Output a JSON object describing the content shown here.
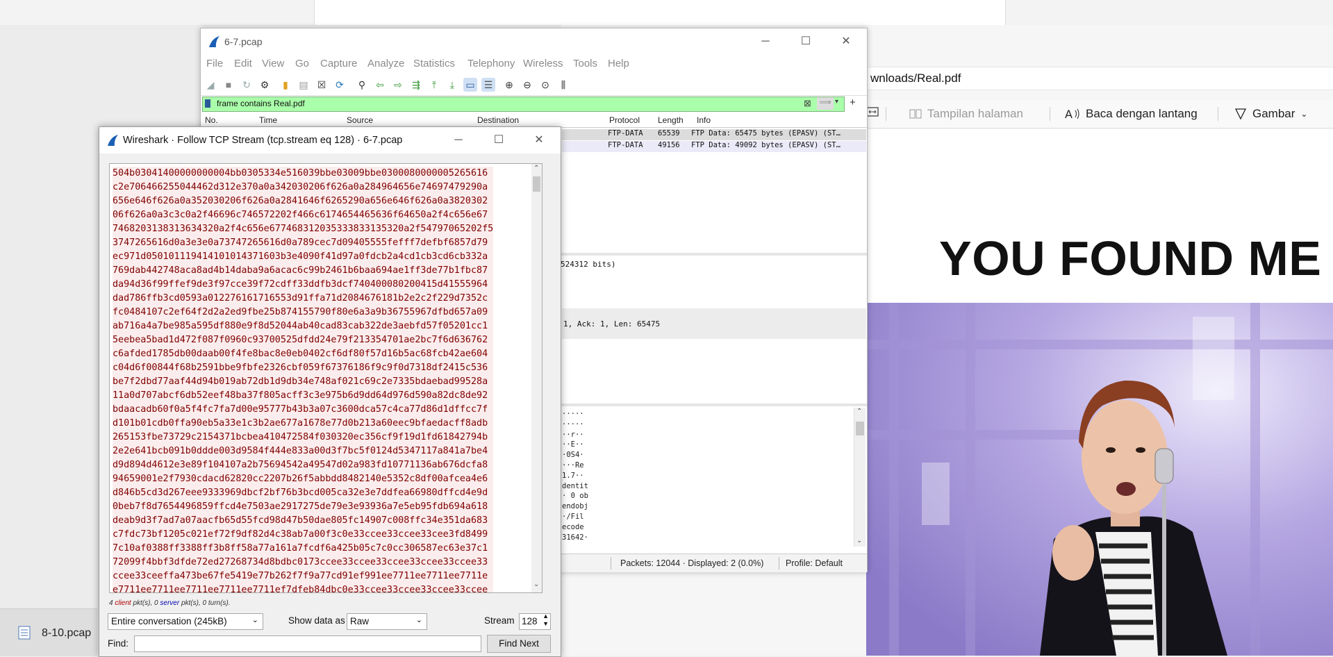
{
  "browser": {
    "address_fragment": "wnloads/Real.pdf",
    "toolbar": {
      "view_label": "Tampilan halaman",
      "read_aloud_label": "Baca dengan lantang",
      "draw_label": "Gambar"
    },
    "pdf_heading": "YOU FOUND ME"
  },
  "taskbar": {
    "item_label": "8-10.pcap"
  },
  "wireshark": {
    "title": "6-7.pcap",
    "menu": [
      "File",
      "Edit",
      "View",
      "Go",
      "Capture",
      "Analyze",
      "Statistics",
      "Telephony",
      "Wireless",
      "Tools",
      "Help"
    ],
    "filter": "frame contains Real.pdf",
    "columns": [
      "No.",
      "Time",
      "Source",
      "Destination",
      "Protocol",
      "Length",
      "Info"
    ],
    "packets": [
      {
        "protocol": "FTP-DATA",
        "length": "65539",
        "info": "FTP Data: 65475 bytes (EPASV) (ST…"
      },
      {
        "protocol": "FTP-DATA",
        "length": "49156",
        "info": "FTP Data: 49092 bytes (EPASV) (ST…"
      }
    ],
    "details": [
      "524312 bits)",
      "1, Ack: 1, Len: 65475"
    ],
    "ascii": [
      "·····",
      "·····",
      "··r··",
      "··E··",
      "·0S4·",
      "···Re",
      "1.7··",
      "dentit",
      "· 0 ob",
      "endobj",
      "·/Fil",
      "ecode",
      "31642·"
    ],
    "status": {
      "packets": "Packets: 12044 · Displayed: 2 (0.0%)",
      "profile": "Profile: Default"
    }
  },
  "follow": {
    "title": "Wireshark · Follow TCP Stream (tcp.stream eq 128) · 6-7.pcap",
    "lines": [
      "504b03041400000000004bb0305334e516039bbe03009bbe0300080000005265616",
      "c2e706466255044462d312e370a0a342030206f626a0a284964656e74697479290a",
      "656e646f626a0a352030206f626a0a2841646f6265290a656e646f626a0a3820302",
      "06f626a0a3c3c0a2f46696c746572202f466c6174654465636f64650a2f4c656e67",
      "7468203138313634320a2f4c656e677468312035333833135320a2f54797065202f5",
      "3747265616d0a3e3e0a73747265616d0a789cec7d09405555fefff7defbf6857d79",
      "ec971d050101119414101014371603b3e4090f41d97a0fdcb2a4cd1cb3cd6cb332a",
      "769dab442748aca8ad4b14daba9a6acac6c99b2461b6baa694ae1ff3de77b1fbc87",
      "da94d36f99ffef9de3f97cce39f72cdff33ddfb3dcf740400080200415d41555964",
      "dad786ffb3cd0593a012276161716553d91ffa71d2084676181b2e2c2f229d7352c",
      "fc0484107c2ef64f2d2a2ed9fbe25b874155790f80e6a3a9b36755967dfbd657a09",
      "ab716a4a7be985a595df880e9f8d52044ab40cad83cab322de3aebfd57f05201cc1",
      "5eebea5bad1d472f087f0960c93700525dfdd24e79f213354701ae2bc7f6d636762",
      "c6afded1785db00daab00f4fe8bac8e0eb0402cf6df80f57d16b5ac68fcb42ae604",
      "c04d6f00844f68b2591bbe9fbfe2326cbf059f67376186f9c9f0d7318df2415c536",
      "be7f2dbd77aaf44d94b019ab72db1d9db34e748af021c69c2e7335bdaebad99528a",
      "11a0d707abcf6db52eef48ba37f805acff3c3e975b6d9dd64d976d590a82dc8de92",
      "bdaacadb60f0a5f4fc7fa7d00e95777b43b3a07c3600dca57c4ca77d86d1dffcc7f",
      "d101b01cdb0ffa90eb5a33e1c3b2ae677a1678e77d0b213a60eec9bfaedacff8adb",
      "265153fbe73729c2154371bcbea410472584f030320ec356cf9f19d1fd61842794b",
      "2e2e641bcb091b0ddde003d9584f444e833a00d3f7bc5f0124d5347117a841a7be4",
      "d9d894d4612e3e89f104107a2b75694542a49547d02a983fd10771136ab676dcfa8",
      "94659001e2f7930cdacd62820cc2207b26f5abbdd8482140e5352c8df00afcea4e6",
      "d846b5cd3d267eee9333969dbcf2bf76b3bcd005ca32e3e7ddfea66980dffcd4e9d",
      "0beb7f8d7654496859ffcd4e7503ae2917275de79e3e93936a7e5eb95fdb694a618",
      "deab9d3f7ad7a07aacfb65d55fcd98d47b50dae805fc14907c008ffc34e351da683",
      "c7fdc73bf1205c021ef72f9df82d4c38ab7a00f3c0e33ccee33ccee33cee3fd8499",
      "7c10af0388ff3388ff3b8ff58a77a161a7fcdf6a425b05c7c0cc306587ec63e37c1",
      "72099f4bbf3dfde72ed27268734d8bdbc0173ccee33ccee33ccee33ccee33ccee33",
      "ccee33ceeffa473be67fe5419e77b262f7f9a77cd91ef991ee7711ee7711ee7711e",
      "e7711ee7711ee7711ee7711ee7711ef7dfeb84dbc0e33ccee33ccee33ccee33ccee"
    ],
    "summary": "4 client pkt(s), 0 server pkt(s), 0 turn(s).",
    "summary_client": "client",
    "summary_server": "server",
    "conversation": "Entire conversation (245kB)",
    "show_as_label": "Show data as",
    "show_as_value": "Raw",
    "stream_label": "Stream",
    "stream_value": "128",
    "find_label": "Find:",
    "find_next": "Find Next",
    "text_color": "#800000"
  }
}
